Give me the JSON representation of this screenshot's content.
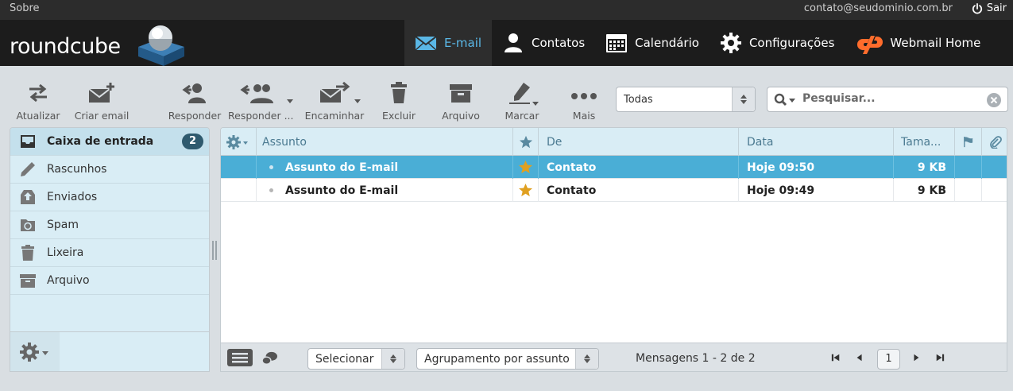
{
  "topbar": {
    "about": "Sobre",
    "user_email": "contato@seudominio.com.br",
    "logout_label": "Sair"
  },
  "logo": {
    "text": "roundcube"
  },
  "nav": [
    {
      "label": "E-mail",
      "icon": "envelope-icon",
      "active": true
    },
    {
      "label": "Contatos",
      "icon": "person-icon"
    },
    {
      "label": "Calendário",
      "icon": "calendar-icon"
    },
    {
      "label": "Configurações",
      "icon": "gear-icon"
    },
    {
      "label": "Webmail Home",
      "icon": "cpanel-icon"
    }
  ],
  "toolbar": {
    "refresh": "Atualizar",
    "compose": "Criar email",
    "reply": "Responder",
    "reply_all": "Responder ...",
    "forward": "Encaminhar",
    "delete": "Excluir",
    "archive": "Arquivo",
    "mark": "Marcar",
    "more": "Mais",
    "filter_value": "Todas",
    "search_placeholder": "Pesquisar..."
  },
  "folders": [
    {
      "label": "Caixa de entrada",
      "icon": "inbox-icon",
      "unread": "2",
      "selected": true
    },
    {
      "label": "Rascunhos",
      "icon": "pencil-icon"
    },
    {
      "label": "Enviados",
      "icon": "sent-icon"
    },
    {
      "label": "Spam",
      "icon": "spam-icon"
    },
    {
      "label": "Lixeira",
      "icon": "trash-icon"
    },
    {
      "label": "Arquivo",
      "icon": "archive-icon"
    }
  ],
  "list": {
    "columns": {
      "subject": "Assunto",
      "from": "De",
      "date": "Data",
      "size": "Tama..."
    },
    "messages": [
      {
        "subject": "Assunto do E-mail",
        "from": "Contato",
        "date": "Hoje 09:50",
        "size": "9 KB",
        "flagged": true,
        "selected": true
      },
      {
        "subject": "Assunto do E-mail",
        "from": "Contato",
        "date": "Hoje 09:49",
        "size": "9 KB",
        "flagged": true,
        "selected": false
      }
    ]
  },
  "footer": {
    "select_label": "Selecionar",
    "threads_label": "Agrupamento por assunto",
    "count_text": "Mensagens 1 - 2 de 2",
    "page": "1"
  },
  "colors": {
    "accent": "#4aaed6",
    "nav_active_text": "#5ab7e6",
    "star": "#e0a020",
    "cpanel_orange": "#ff6c2c",
    "badge": "#2f5a6e"
  }
}
